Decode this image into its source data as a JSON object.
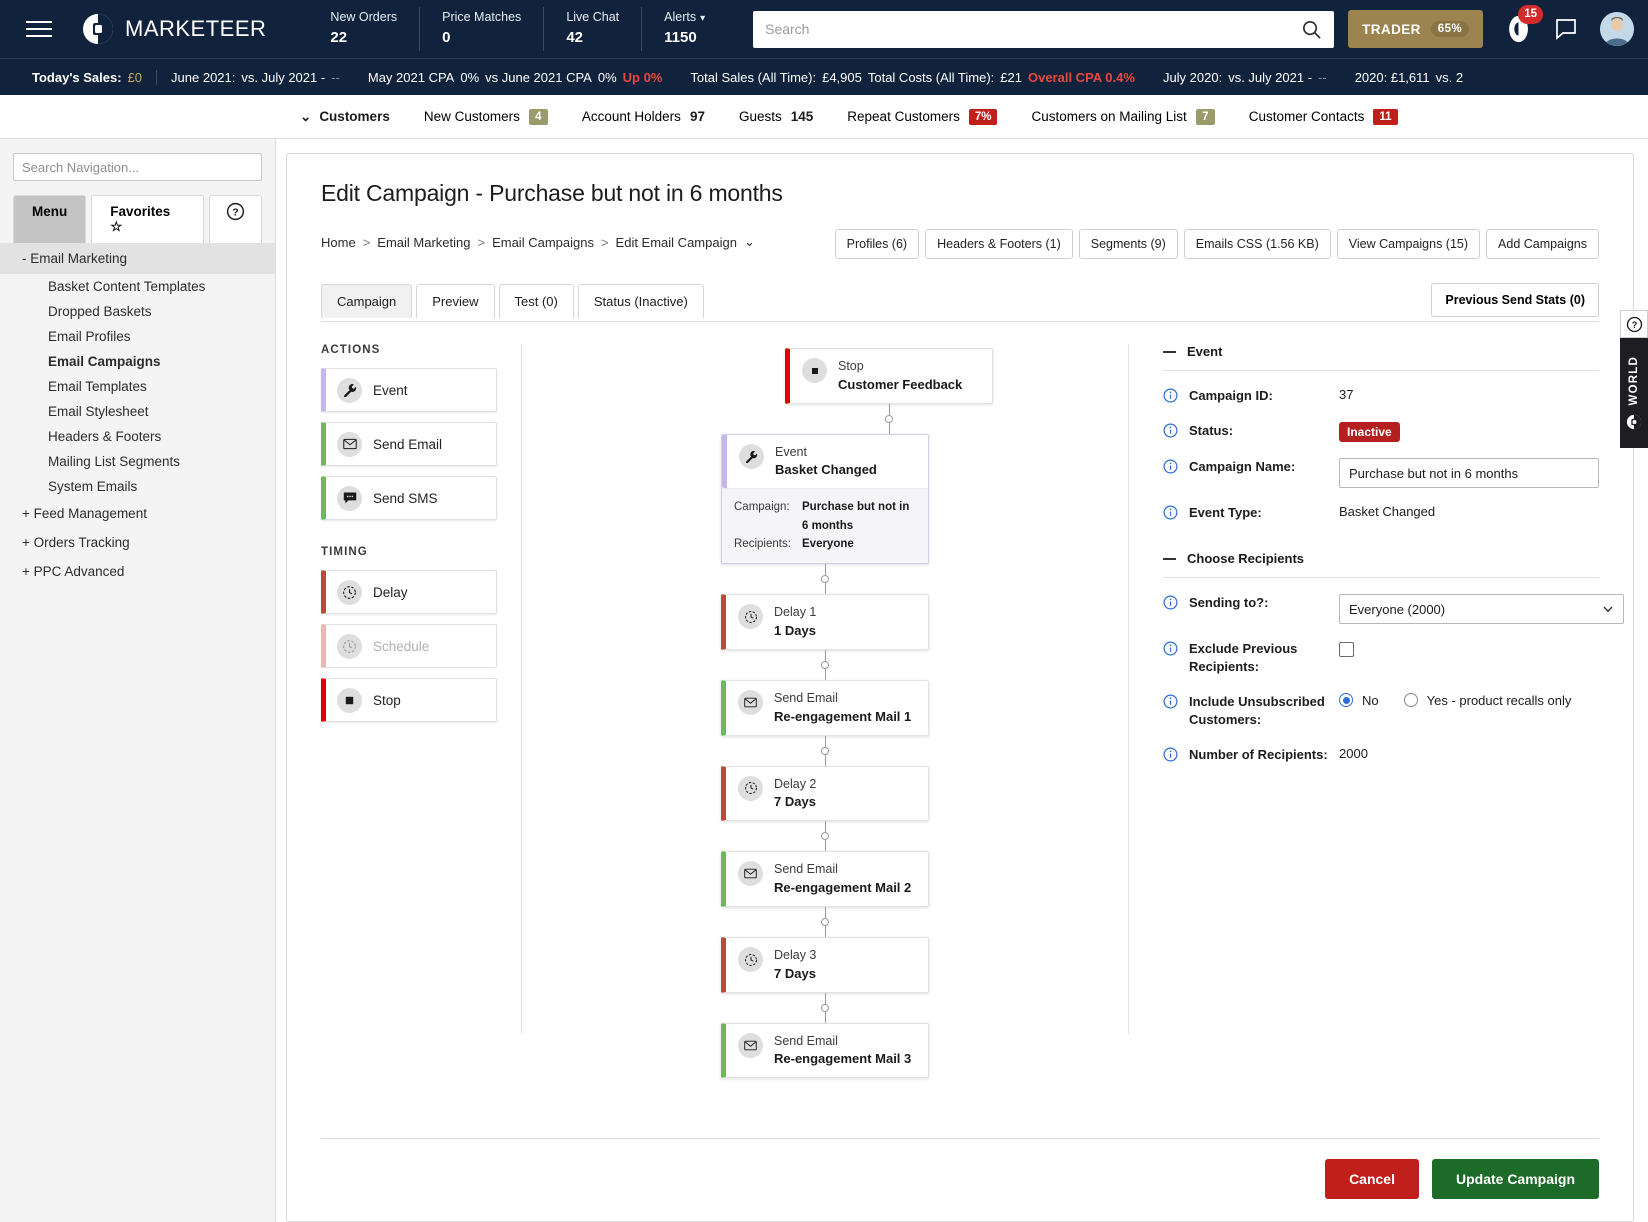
{
  "topnav": {
    "brand": "MARKETEER",
    "kpis": [
      {
        "label": "New Orders",
        "value": "22"
      },
      {
        "label": "Price Matches",
        "value": "0"
      },
      {
        "label": "Live Chat",
        "value": "42"
      },
      {
        "label": "Alerts",
        "value": "1150",
        "has_caret": true
      }
    ],
    "search_placeholder": "Search",
    "search_value": "",
    "trader_label": "TRADER",
    "trader_pct": "65%",
    "notification_count": "15"
  },
  "ticker": {
    "todays_sales_label": "Today's Sales:",
    "todays_sales_value": "£0",
    "item2_a": "June 2021:",
    "item2_b": "vs. July 2021 -",
    "item2_c": "--",
    "item3_a": "May 2021 CPA",
    "item3_b": "0%",
    "item3_c": "vs June 2021 CPA",
    "item3_d": "0%",
    "item3_e": "Up 0%",
    "item4_a": "Total Sales (All Time):",
    "item4_b": "£4,905",
    "item4_c": "Total Costs (All Time):",
    "item4_d": "£21",
    "item4_e": "Overall CPA 0.4%",
    "item5_a": "July 2020:",
    "item5_b": "vs. July 2021 -",
    "item5_c": "--",
    "item6_a": "2020: £1,611",
    "item6_b": "vs. 2"
  },
  "custbar": {
    "lead": "Customers",
    "items": [
      {
        "label": "New Customers",
        "value": "4",
        "style": "olive"
      },
      {
        "label": "Account Holders",
        "value": "97",
        "style": "plain"
      },
      {
        "label": "Guests",
        "value": "145",
        "style": "plain"
      },
      {
        "label": "Repeat Customers",
        "value": "7%",
        "style": "red"
      },
      {
        "label": "Customers on Mailing List",
        "value": "7",
        "style": "olive"
      },
      {
        "label": "Customer Contacts",
        "value": "11",
        "style": "red"
      }
    ]
  },
  "sidebar": {
    "search_placeholder": "Search Navigation...",
    "search_value": "",
    "tab_menu": "Menu",
    "tab_favorites": "Favorites ☆",
    "section": "- Email Marketing",
    "items": [
      {
        "label": "Basket Content Templates"
      },
      {
        "label": "Dropped Baskets"
      },
      {
        "label": "Email Profiles"
      },
      {
        "label": "Email Campaigns"
      },
      {
        "label": "Email Templates"
      },
      {
        "label": "Email Stylesheet"
      },
      {
        "label": "Headers & Footers"
      },
      {
        "label": "Mailing List Segments"
      },
      {
        "label": "System Emails"
      }
    ],
    "groups": [
      {
        "label": "+ Feed Management"
      },
      {
        "label": "+ Orders Tracking"
      },
      {
        "label": "+ PPC Advanced"
      }
    ]
  },
  "page": {
    "title": "Edit Campaign - Purchase but not in 6 months",
    "breadcrumb": [
      "Home",
      "Email Marketing",
      "Email Campaigns",
      "Edit Email Campaign"
    ],
    "action_buttons": [
      "Profiles (6)",
      "Headers & Footers (1)",
      "Segments (9)",
      "Emails CSS (1.56 KB)",
      "View Campaigns (15)",
      "Add Campaigns"
    ],
    "tabs": [
      {
        "label": "Campaign",
        "selected": true
      },
      {
        "label": "Preview",
        "selected": false
      },
      {
        "label": "Test (0)",
        "selected": false
      },
      {
        "label": "Status (Inactive)",
        "selected": false
      }
    ],
    "stats_button": "Previous Send Stats (0)"
  },
  "palette": {
    "actions_heading": "ACTIONS",
    "timing_heading": "TIMING",
    "actions": [
      {
        "label": "Event",
        "icon": "wrench-icon",
        "color": "#c6b6ee",
        "disabled": false
      },
      {
        "label": "Send Email",
        "icon": "envelope-icon",
        "color": "#6cba55",
        "disabled": false
      },
      {
        "label": "Send SMS",
        "icon": "chat-icon",
        "color": "#6cba55",
        "disabled": false
      }
    ],
    "timing": [
      {
        "label": "Delay",
        "icon": "clock-icon",
        "color": "#bb4a3c",
        "disabled": false
      },
      {
        "label": "Schedule",
        "icon": "clock-icon",
        "color": "#eab7b1",
        "disabled": true
      },
      {
        "label": "Stop",
        "icon": "stop-icon",
        "color": "#e00000",
        "disabled": false
      }
    ]
  },
  "flow": {
    "stop_node": {
      "type": "Stop",
      "name": "Customer Feedback",
      "icon": "stop-icon",
      "color": "#e00000"
    },
    "selected_node": {
      "type": "Event",
      "name": "Basket Changed",
      "icon": "wrench-icon",
      "color": "#c6b6ee",
      "meta_campaign_label": "Campaign:",
      "meta_campaign_value": "Purchase but not in 6 months",
      "meta_recipients_label": "Recipients:",
      "meta_recipients_value": "Everyone"
    },
    "nodes": [
      {
        "type": "Delay 1",
        "name": "1 Days",
        "icon": "clock-icon",
        "color": "#bb4a3c"
      },
      {
        "type": "Send Email",
        "name": "Re-engagement Mail 1",
        "icon": "envelope-icon",
        "color": "#6cba55"
      },
      {
        "type": "Delay 2",
        "name": "7 Days",
        "icon": "clock-icon",
        "color": "#bb4a3c"
      },
      {
        "type": "Send Email",
        "name": "Re-engagement Mail 2",
        "icon": "envelope-icon",
        "color": "#6cba55"
      },
      {
        "type": "Delay 3",
        "name": "7 Days",
        "icon": "clock-icon",
        "color": "#bb4a3c"
      },
      {
        "type": "Send Email",
        "name": "Re-engagement Mail 3",
        "icon": "envelope-icon",
        "color": "#6cba55"
      }
    ]
  },
  "details": {
    "event_section": "Event",
    "campaign_id_label": "Campaign ID:",
    "campaign_id_value": "37",
    "status_label": "Status:",
    "status_value": "Inactive",
    "campaign_name_label": "Campaign Name:",
    "campaign_name_value": "Purchase but not in 6 months",
    "event_type_label": "Event Type:",
    "event_type_value": "Basket Changed",
    "recipients_section": "Choose Recipients",
    "sending_to_label": "Sending to?:",
    "sending_to_value": "Everyone (2000)",
    "exclude_label": "Exclude Previous Recipients:",
    "exclude_checked": false,
    "include_unsub_label": "Include Unsubscribed Customers:",
    "radio_no": "No",
    "radio_yes": "Yes - product recalls only",
    "radio_selected": "No",
    "num_recipients_label": "Number of Recipients:",
    "num_recipients_value": "2000"
  },
  "footer": {
    "cancel": "Cancel",
    "update": "Update Campaign"
  },
  "edge_widget": {
    "help": "?",
    "label": "WORLD"
  },
  "colors": {
    "navy": "#11233c",
    "gold": "#9c8450",
    "red": "#c0201c",
    "green": "#1d6b28",
    "blue_info": "#2b6fd6"
  }
}
